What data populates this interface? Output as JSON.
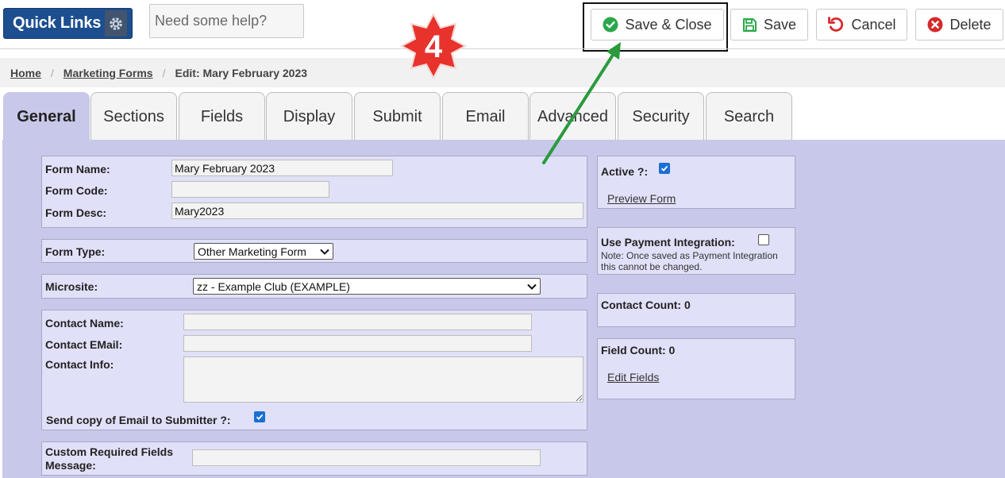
{
  "header": {
    "quick_links_label": "Quick Links",
    "help_placeholder": "Need some help?",
    "buttons": {
      "save_close": "Save & Close",
      "save": "Save",
      "cancel": "Cancel",
      "delete": "Delete"
    },
    "step_badge": "4"
  },
  "breadcrumb": {
    "home": "Home",
    "marketing_forms": "Marketing Forms",
    "current": "Edit: Mary February 2023"
  },
  "tabs": [
    "General",
    "Sections",
    "Fields",
    "Display",
    "Submit",
    "Email",
    "Advanced",
    "Security",
    "Search"
  ],
  "active_tab": "General",
  "form": {
    "name_label": "Form Name:",
    "name_value": "Mary February 2023",
    "code_label": "Form Code:",
    "code_value": "",
    "desc_label": "Form Desc:",
    "desc_value": "Mary2023",
    "type_label": "Form Type:",
    "type_value": "Other Marketing Form",
    "microsite_label": "Microsite:",
    "microsite_value": "zz - Example Club (EXAMPLE)",
    "contact_name_label": "Contact Name:",
    "contact_name_value": "",
    "contact_email_label": "Contact EMail:",
    "contact_email_value": "",
    "contact_info_label": "Contact Info:",
    "contact_info_value": "",
    "send_copy_label": "Send copy of Email to Submitter ?:",
    "send_copy_checked": true,
    "custom_required_label_1": "Custom Required Fields",
    "custom_required_label_2": "Message:",
    "custom_required_value": ""
  },
  "side": {
    "active_label": "Active ?:",
    "active_checked": true,
    "preview_link": "Preview Form",
    "payment_label": "Use Payment Integration:",
    "payment_checked": false,
    "payment_note": "Note: Once saved as Payment Integration this cannot be changed.",
    "contact_count_label": "Contact Count: 0",
    "field_count_label": "Field Count: 0",
    "edit_fields_link": "Edit Fields"
  },
  "colors": {
    "panel_bg": "#c8c8ea",
    "box_bg": "#e0e0f8",
    "quick_links_bg": "#1d4e8f",
    "save_close_icon": "#2aa84a",
    "cancel_icon": "#d42a2a",
    "delete_icon": "#d42a2a",
    "badge_red": "#e8322c",
    "arrow_green": "#2a9a3c"
  }
}
